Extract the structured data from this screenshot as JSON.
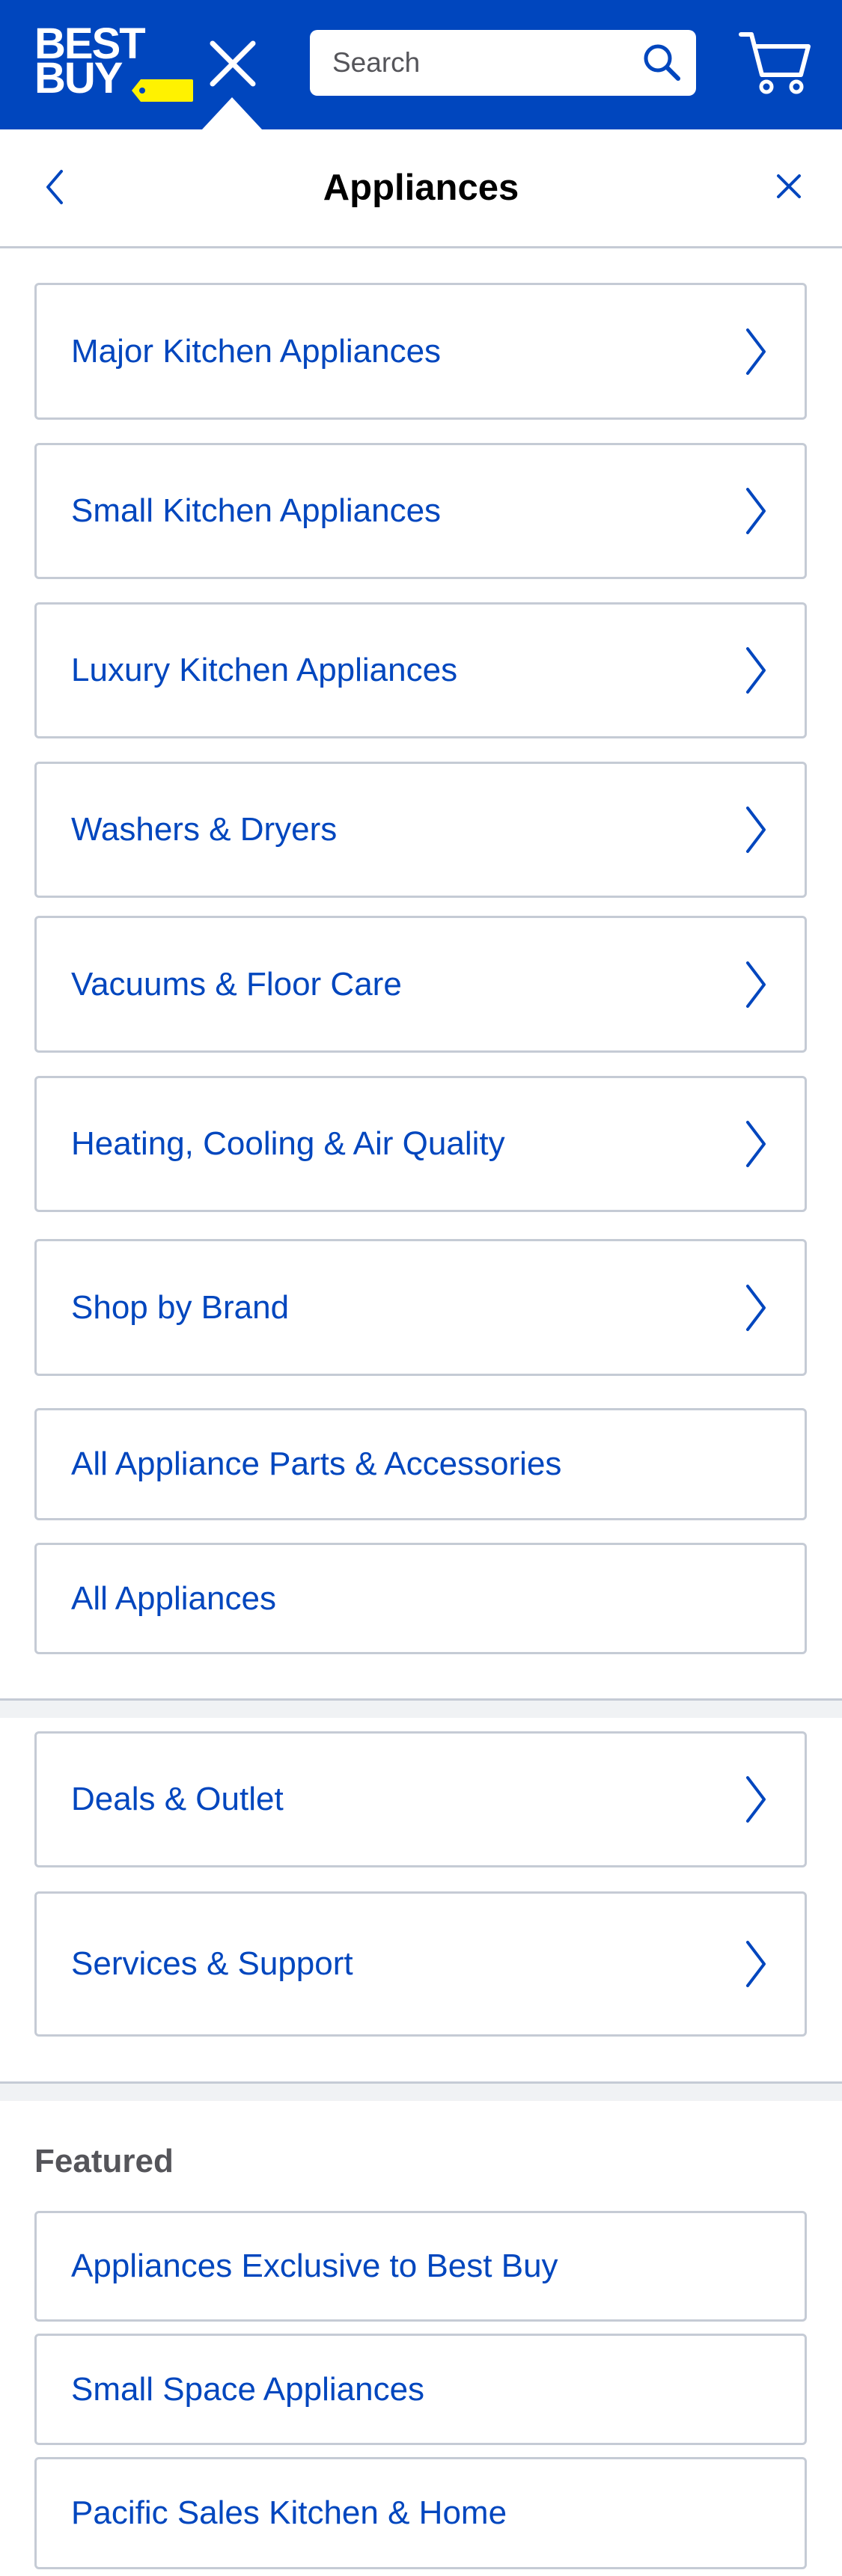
{
  "header": {
    "logo_line1": "BEST",
    "logo_line2": "BUY",
    "logo_tag_color": "#fff200",
    "brand_color": "#0046be",
    "search_placeholder": "Search",
    "search_value": ""
  },
  "nav": {
    "title": "Appliances"
  },
  "categories": [
    {
      "label": "Major Kitchen Appliances",
      "chevron": true
    },
    {
      "label": "Small Kitchen Appliances",
      "chevron": true
    },
    {
      "label": "Luxury Kitchen Appliances",
      "chevron": true
    },
    {
      "label": "Washers & Dryers",
      "chevron": true
    },
    {
      "label": "Vacuums & Floor Care",
      "chevron": true
    },
    {
      "label": "Heating, Cooling & Air Quality",
      "chevron": true
    },
    {
      "label": "Shop by Brand",
      "chevron": true
    },
    {
      "label": "All Appliance Parts & Accessories",
      "chevron": false
    },
    {
      "label": "All Appliances",
      "chevron": false
    }
  ],
  "more": [
    {
      "label": "Deals & Outlet",
      "chevron": true
    },
    {
      "label": "Services & Support",
      "chevron": true
    }
  ],
  "featured": {
    "heading": "Featured",
    "items": [
      {
        "label": "Appliances Exclusive to Best Buy"
      },
      {
        "label": "Small Space Appliances"
      },
      {
        "label": "Pacific Sales Kitchen & Home"
      }
    ]
  }
}
